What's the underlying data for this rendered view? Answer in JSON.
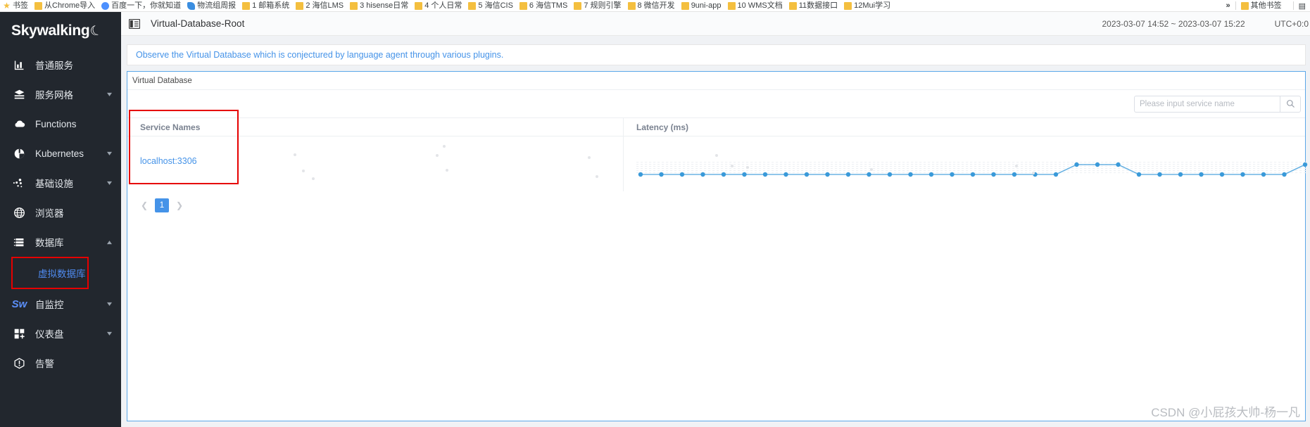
{
  "browser": {
    "bookmarks": [
      {
        "label": "书签",
        "icon": "star-icon"
      },
      {
        "label": "从Chrome导入",
        "icon": "folder-icon"
      },
      {
        "label": "百度一下，你就知道",
        "icon": "baidu-icon"
      },
      {
        "label": "物流组周报",
        "icon": "cloud-icon"
      },
      {
        "label": "1 邮箱系统",
        "icon": "folder-icon"
      },
      {
        "label": "2 海信LMS",
        "icon": "folder-icon"
      },
      {
        "label": "3 hisense日常",
        "icon": "folder-icon"
      },
      {
        "label": "4 个人日常",
        "icon": "folder-icon"
      },
      {
        "label": "5 海信CIS",
        "icon": "folder-icon"
      },
      {
        "label": "6 海信TMS",
        "icon": "folder-icon"
      },
      {
        "label": "7 规则引擎",
        "icon": "folder-icon"
      },
      {
        "label": "8 微信开发",
        "icon": "folder-icon"
      },
      {
        "label": "9uni-app",
        "icon": "folder-icon"
      },
      {
        "label": "10 WMS文档",
        "icon": "folder-icon"
      },
      {
        "label": "11数据接口",
        "icon": "folder-icon"
      },
      {
        "label": "12Mui学习",
        "icon": "folder-icon"
      }
    ],
    "overflow_label": "»",
    "other_bookmarks": {
      "label": "其他书签",
      "icon": "folder-icon"
    },
    "reading_list_icon": "reading-list-icon"
  },
  "sidebar": {
    "brand": "Skywalking",
    "items": [
      {
        "label": "普通服务",
        "icon": "chart-icon",
        "expandable": false
      },
      {
        "label": "服务网格",
        "icon": "mesh-icon",
        "expandable": true,
        "expanded": false
      },
      {
        "label": "Functions",
        "icon": "cloud-icon",
        "expandable": false
      },
      {
        "label": "Kubernetes",
        "icon": "k8s-icon",
        "expandable": true,
        "expanded": false
      },
      {
        "label": "基础设施",
        "icon": "infrastructure-icon",
        "expandable": true,
        "expanded": false
      },
      {
        "label": "浏览器",
        "icon": "globe-icon",
        "expandable": false
      },
      {
        "label": "数据库",
        "icon": "database-icon",
        "expandable": true,
        "expanded": true
      },
      {
        "label": "自监控",
        "icon": "sw-icon",
        "expandable": true,
        "expanded": false
      },
      {
        "label": "仪表盘",
        "icon": "dashboard-icon",
        "expandable": true,
        "expanded": false
      },
      {
        "label": "告警",
        "icon": "alarm-icon",
        "expandable": false
      }
    ],
    "submenu": {
      "label": "虚拟数据库",
      "parent": "数据库",
      "highlighted": true
    },
    "sw_logo_text": "Sw"
  },
  "header": {
    "collapse_icon": "collapse-sidebar-icon",
    "title": "Virtual-Database-Root",
    "time_range": "2023-03-07 14:52 ~ 2023-03-07 15:22",
    "timezone": "UTC+0:0"
  },
  "main": {
    "notice": "Observe the Virtual Database which is conjectured by language agent through various plugins.",
    "tab_label": "Virtual Database",
    "search": {
      "placeholder": "Please input service name",
      "value": "",
      "button_icon": "search-icon"
    },
    "grid": {
      "columns": [
        "Service Names",
        "Latency (ms)"
      ],
      "rows": [
        {
          "service_name": "localhost:3306"
        }
      ]
    },
    "pagination": {
      "prev_icon": "chevron-left-icon",
      "next_icon": "chevron-right-icon",
      "pages": [
        "1"
      ],
      "current": "1"
    }
  },
  "chart_data": {
    "type": "line",
    "title": "Latency (ms)",
    "xlabel": "",
    "ylabel": "Latency (ms)",
    "legend": [],
    "grid": false,
    "series": [
      {
        "name": "localhost:3306",
        "color": "#3a9ad9",
        "values": [
          1,
          1,
          1,
          1,
          1,
          1,
          1,
          1,
          1,
          1,
          1,
          1,
          1,
          1,
          1,
          1,
          1,
          1,
          1,
          1,
          1,
          2,
          2,
          2,
          1,
          1,
          1,
          1,
          1,
          1,
          1,
          1,
          2
        ]
      }
    ],
    "point_count": 33
  },
  "annotations": {
    "highlight_boxes": [
      {
        "target": "sidebar-submenu-virtual-database",
        "color": "#e60000"
      },
      {
        "target": "service-names-column",
        "color": "#e60000"
      }
    ]
  },
  "watermark": "CSDN @小屁孩大帅-杨一凡"
}
